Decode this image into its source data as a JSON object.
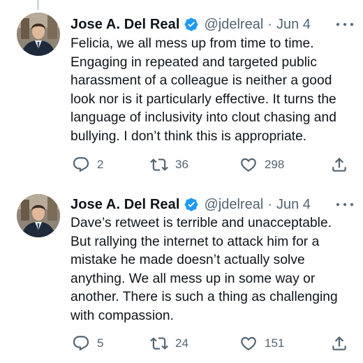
{
  "tweets": [
    {
      "display_name": "Jose A. Del Real",
      "handle": "@jdelreal",
      "separator": "·",
      "date": "Jun 4",
      "text": "Felicia, we all mess up from time to time. Engaging in repeated and targeted public harassment of a colleague is neither a good look nor is it particularly effective. It turns the language of inclusivity into clout chasing and bullying. I don’t think this is appropriate.",
      "replies": "2",
      "retweets": "36",
      "likes": "298"
    },
    {
      "display_name": "Jose A. Del Real",
      "handle": "@jdelreal",
      "separator": "·",
      "date": "Jun 4",
      "text": "Dave’s retweet is terrible and unacceptable. But rallying the internet to attack him for a mistake he made doesn’t actually solve anything. We all mess up in some way or another. There is such a thing as challenging with compassion.",
      "replies": "5",
      "retweets": "24",
      "likes": "151"
    }
  ],
  "colors": {
    "text": "#0f1419",
    "muted": "#536471",
    "verified_blue": "#1d9bf0",
    "thread_line": "#cfd9de"
  },
  "icons": {
    "verified": "verified-badge-icon",
    "more": "more-options-icon",
    "reply": "reply-icon",
    "retweet": "retweet-icon",
    "like": "heart-icon",
    "share": "share-icon"
  }
}
